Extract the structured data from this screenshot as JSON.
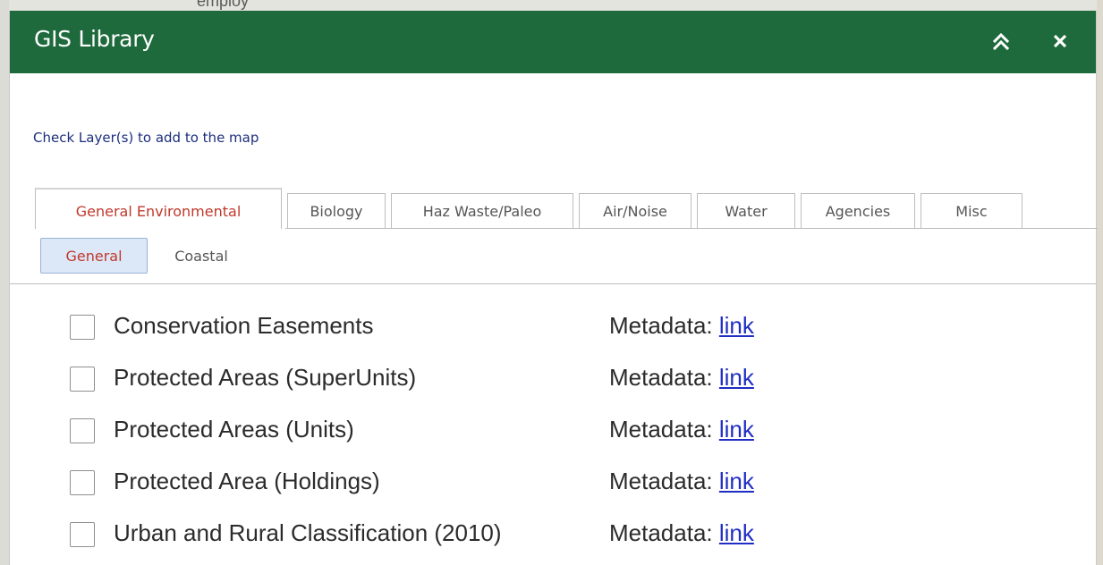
{
  "background": {
    "faint_text": "employ",
    "colors": {
      "panel_bg": "#ffffff",
      "page_bg": "#e4e4de"
    }
  },
  "header": {
    "title": "GIS Library",
    "collapse_icon": "double-chevron-up-icon",
    "close_icon": "close-icon",
    "color": "#1e6a3c"
  },
  "instruction": "Check Layer(s) to add to the map",
  "tabs": [
    {
      "label": "General Environmental",
      "active": true
    },
    {
      "label": "Biology",
      "active": false
    },
    {
      "label": "Haz Waste/Paleo",
      "active": false
    },
    {
      "label": "Air/Noise",
      "active": false
    },
    {
      "label": "Water",
      "active": false
    },
    {
      "label": "Agencies",
      "active": false
    },
    {
      "label": "Misc",
      "active": false
    }
  ],
  "subtabs": [
    {
      "label": "General",
      "active": true
    },
    {
      "label": "Coastal",
      "active": false
    }
  ],
  "layers": [
    {
      "name": "Conservation Easements",
      "checked": false,
      "meta_label": "Metadata:",
      "link_text": "link"
    },
    {
      "name": "Protected Areas (SuperUnits)",
      "checked": false,
      "meta_label": "Metadata:",
      "link_text": "link"
    },
    {
      "name": "Protected Areas (Units)",
      "checked": false,
      "meta_label": "Metadata:",
      "link_text": "link"
    },
    {
      "name": "Protected Area (Holdings)",
      "checked": false,
      "meta_label": "Metadata:",
      "link_text": "link"
    },
    {
      "name": "Urban and Rural Classification (2010)",
      "checked": false,
      "meta_label": "Metadata:",
      "link_text": "link"
    }
  ],
  "accent_colors": {
    "active_tab_text": "#c0392b",
    "instruction_text": "#1c2f7d",
    "link": "#1f2dc2",
    "subtab_active_bg": "#dce8f8"
  }
}
